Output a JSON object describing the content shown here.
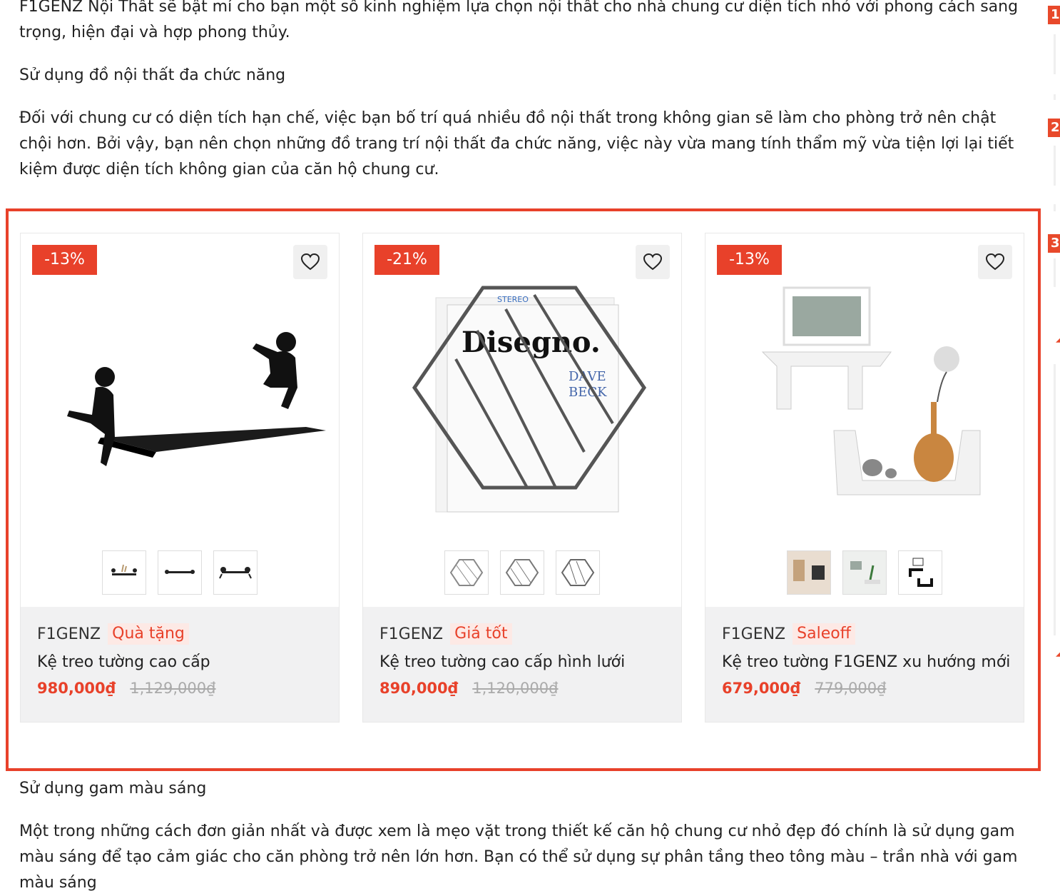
{
  "article": {
    "intro": "F1GENZ Nội Thất sẽ bật mí cho bạn một số kinh nghiệm lựa chọn nội thất cho nhà chung cư diện tích nhỏ với phong cách sang trọng, hiện đại và hợp phong thủy.",
    "heading_multifunction": "Sử dụng đồ nội thất đa chức năng",
    "paragraph_multifunction": "Đối với chung cư có diện tích hạn chế, việc bạn bố trí quá nhiều đồ nội thất trong không gian sẽ làm cho phòng trở nên chật chội hơn. Bởi vậy, bạn nên chọn những đồ trang trí nội thất đa chức năng, việc này vừa mang tính thẩm mỹ vừa tiện lợi lại tiết kiệm được diện tích không gian của căn hộ chung cư.",
    "heading_light_colors": "Sử dụng gam màu sáng",
    "paragraph_light_colors": "Một trong những cách đơn giản nhất và được xem là mẹo vặt trong thiết kế căn hộ chung cư nhỏ đẹp đó chính là sử dụng gam màu sáng để tạo cảm giác cho căn phòng trở nên lớn hơn. Bạn có thể sử dụng sự phân tầng theo tông màu – trần nhà với gam màu sáng"
  },
  "sidebar_badges": [
    "1",
    "2",
    "3"
  ],
  "products": [
    {
      "discount": "-13%",
      "brand": "F1GENZ",
      "tag": "Quà tặng",
      "name": "Kệ treo tường cao cấp",
      "price": "980,000₫",
      "old_price": "1,129,000₫"
    },
    {
      "discount": "-21%",
      "brand": "F1GENZ",
      "tag": "Giá tốt",
      "name": "Kệ treo tường cao cấp hình lưới",
      "price": "890,000₫",
      "old_price": "1,120,000₫"
    },
    {
      "discount": "-13%",
      "brand": "F1GENZ",
      "tag": "Saleoff",
      "name": "Kệ treo tường F1GENZ xu hướng mới",
      "price": "679,000₫",
      "old_price": "779,000₫"
    }
  ],
  "colors": {
    "accent": "#e8412a",
    "info_bg": "#f1f1f2"
  },
  "icons": {
    "wishlist": "heart-icon"
  }
}
